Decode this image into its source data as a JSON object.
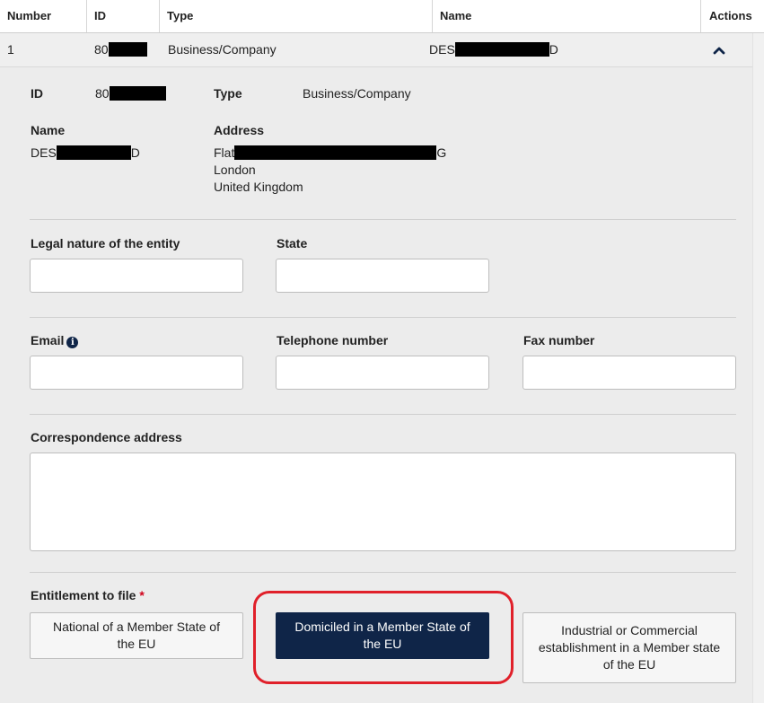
{
  "table": {
    "headers": {
      "number": "Number",
      "id": "ID",
      "type": "Type",
      "name": "Name",
      "actions": "Actions"
    },
    "row": {
      "number": "1",
      "id_prefix": "80",
      "type": "Business/Company",
      "name_prefix": "DES",
      "name_suffix": "D",
      "collapse_icon": "chevron-up-icon"
    }
  },
  "detail": {
    "id_label": "ID",
    "id_prefix": "80",
    "type_label": "Type",
    "type_value": "Business/Company",
    "name_label": "Name",
    "name_prefix": "DES",
    "name_suffix": "D",
    "address_label": "Address",
    "address_line1_prefix": "Flat",
    "address_line1_suffix": "G",
    "address_line2": "London",
    "address_line3": "United Kingdom"
  },
  "form": {
    "legal_nature_label": "Legal nature of the entity",
    "legal_nature_value": "",
    "state_label": "State",
    "state_value": "",
    "email_label": "Email",
    "email_value": "",
    "telephone_label": "Telephone number",
    "telephone_value": "",
    "fax_label": "Fax number",
    "fax_value": "",
    "correspondence_label": "Correspondence address",
    "correspondence_value": "",
    "entitlement_label": "Entitlement to file",
    "required_marker": "*",
    "entitlement_options": [
      {
        "label": "National of a Member State of the EU",
        "selected": false
      },
      {
        "label": "Domiciled in a Member State of the EU",
        "selected": true
      },
      {
        "label": "Industrial or Commercial establishment in a Member state of the EU",
        "selected": false
      }
    ]
  },
  "colors": {
    "selected_button": "#0f2548",
    "highlight": "#e0202a",
    "required": "#d0021b",
    "panel_bg": "#ececec"
  }
}
